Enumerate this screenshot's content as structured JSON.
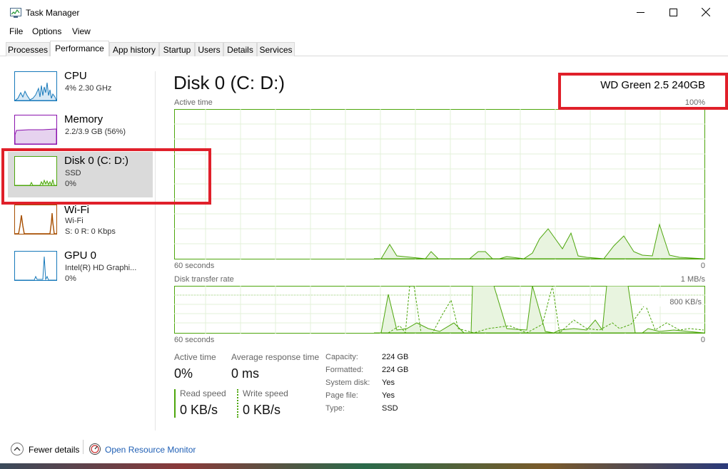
{
  "window": {
    "title": "Task Manager"
  },
  "menu": [
    "File",
    "Options",
    "View"
  ],
  "tabs": [
    "Processes",
    "Performance",
    "App history",
    "Startup",
    "Users",
    "Details",
    "Services"
  ],
  "active_tab": "Performance",
  "sidebar": {
    "items": [
      {
        "title": "CPU",
        "sub1": "4% 2.30 GHz",
        "sub2": ""
      },
      {
        "title": "Memory",
        "sub1": "2.2/3.9 GB (56%)",
        "sub2": ""
      },
      {
        "title": "Disk 0 (C: D:)",
        "sub1": "SSD",
        "sub2": "0%"
      },
      {
        "title": "Wi-Fi",
        "sub1": "Wi-Fi",
        "sub2": "S: 0 R: 0 Kbps"
      },
      {
        "title": "GPU 0",
        "sub1": "Intel(R) HD Graphi...",
        "sub2": "0%"
      }
    ]
  },
  "main": {
    "title": "Disk 0 (C: D:)",
    "model": "WD Green 2.5 240GB",
    "active_time_label": "Active time",
    "active_time_max": "100%",
    "graph1_left": "60 seconds",
    "graph1_right": "0",
    "transfer_label": "Disk transfer rate",
    "transfer_max": "1 MB/s",
    "transfer_mid": "800 KB/s",
    "graph2_left": "60 seconds",
    "graph2_right": "0"
  },
  "stats": {
    "active_time_label": "Active time",
    "active_time_value": "0%",
    "avg_response_label": "Average response time",
    "avg_response_value": "0 ms",
    "read_label": "Read speed",
    "read_value": "0 KB/s",
    "write_label": "Write speed",
    "write_value": "0 KB/s"
  },
  "info": [
    {
      "label": "Capacity:",
      "value": "224 GB"
    },
    {
      "label": "Formatted:",
      "value": "224 GB"
    },
    {
      "label": "System disk:",
      "value": "Yes"
    },
    {
      "label": "Page file:",
      "value": "Yes"
    },
    {
      "label": "Type:",
      "value": "SSD"
    }
  ],
  "footer": {
    "fewer_details": "Fewer details",
    "open_resource_monitor": "Open Resource Monitor"
  },
  "colors": {
    "disk_green": "#4da60c",
    "cpu_blue": "#1779ba",
    "memory_purple": "#8b12ae",
    "wifi_orange": "#a74f01",
    "gpu_blue": "#1779ba",
    "highlight_red": "#e0202a"
  }
}
